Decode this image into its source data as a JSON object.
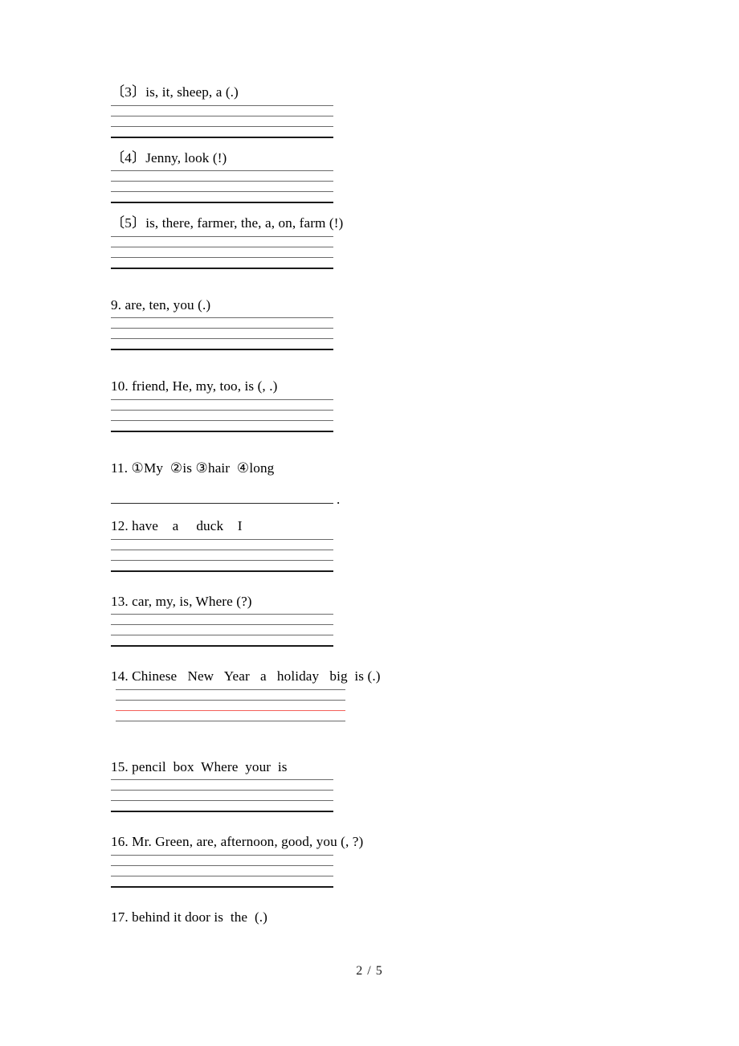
{
  "document": {
    "page_label": "2 / 5",
    "colors": {
      "text": "#000000",
      "rule_thin": "#6e6e6e",
      "rule_thick": "#1a1a1a",
      "rule_red": "#f4605a",
      "bracket_gray": "#9a9a9a",
      "page_background": "#ffffff"
    }
  },
  "questions": [
    {
      "id": "q3",
      "text": "〔3〕is, it, sheep, a (.)",
      "answer_lines": 4,
      "style": "ruled"
    },
    {
      "id": "q4",
      "text": "〔4〕Jenny, look (!)",
      "answer_lines": 4,
      "style": "ruled"
    },
    {
      "id": "q5",
      "text": "〔5〕is, there, farmer, the, a, on, farm (!)",
      "answer_lines": 4,
      "style": "ruled"
    },
    {
      "id": "q9",
      "text": "9. are, ten, you (.)",
      "answer_lines": 4,
      "style": "ruled"
    },
    {
      "id": "q10",
      "text": "10. friend, He, my, too, is (, .)",
      "answer_lines": 4,
      "style": "ruled"
    },
    {
      "id": "q11",
      "text": "11. ①My  ②is ③hair  ④long",
      "answer_lines": 1,
      "style": "single-underline",
      "trailing_punctuation": "."
    },
    {
      "id": "q12",
      "text": "12. have    a     duck    I",
      "answer_lines": 4,
      "style": "ruled"
    },
    {
      "id": "q13",
      "text": "13. car, my, is, Where (?)",
      "answer_lines": 4,
      "style": "ruled"
    },
    {
      "id": "q14",
      "text": "14. Chinese   New   Year   a   holiday   big  is (.)",
      "answer_lines": 4,
      "style": "ruled-wide-red",
      "red_line_index": 3
    },
    {
      "id": "q15",
      "text": "15. pencil  box  Where  your  is",
      "answer_lines": 4,
      "style": "ruled"
    },
    {
      "id": "q16",
      "text": "16. Mr. Green, are, afternoon, good, you (, ?)",
      "answer_lines": 4,
      "style": "ruled"
    },
    {
      "id": "q17",
      "text": "17. behind it door is  the  (.)",
      "answer_lines": 0,
      "style": "none"
    }
  ]
}
